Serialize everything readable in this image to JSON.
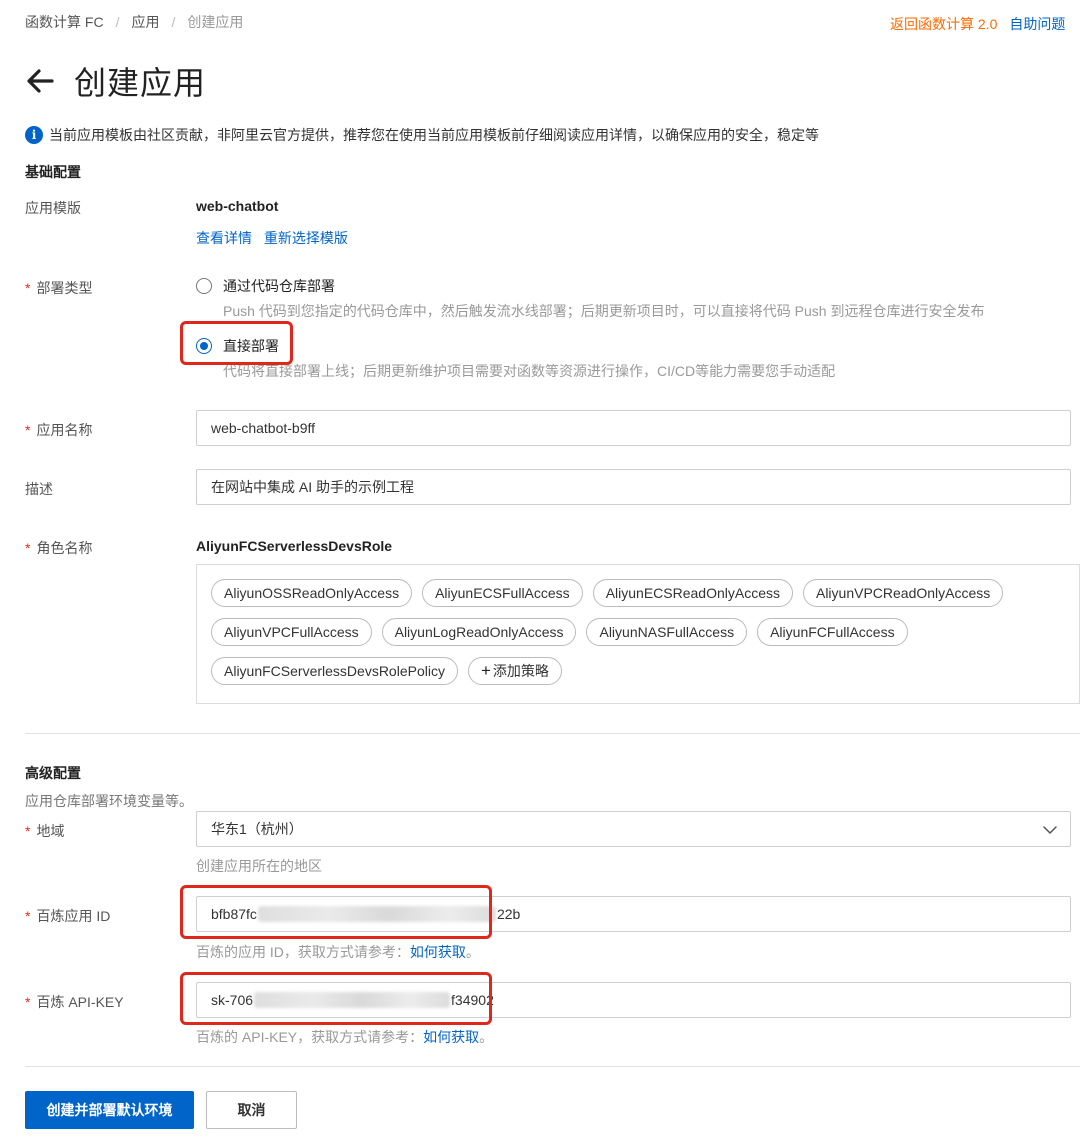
{
  "breadcrumb": {
    "items": [
      "函数计算 FC",
      "应用",
      "创建应用"
    ]
  },
  "top_links": {
    "return_label": "返回函数计算 2.0",
    "help_label": "自助问题"
  },
  "page": {
    "title": "创建应用"
  },
  "notice": "当前应用模板由社区贡献，非阿里云官方提供，推荐您在使用当前应用模板前仔细阅读应用详情，以确保应用的安全，稳定等",
  "basic": {
    "section_title": "基础配置",
    "template": {
      "label": "应用模版",
      "value": "web-chatbot",
      "link_details": "查看详情",
      "link_reselect": "重新选择模版"
    },
    "deploy_type": {
      "label": "部署类型",
      "options": [
        {
          "label": "通过代码仓库部署",
          "desc": "Push 代码到您指定的代码仓库中，然后触发流水线部署；后期更新项目时，可以直接将代码 Push 到远程仓库进行安全发布",
          "checked": false
        },
        {
          "label": "直接部署",
          "desc": "代码将直接部署上线；后期更新维护项目需要对函数等资源进行操作，CI/CD等能力需要您手动适配",
          "checked": true
        }
      ]
    },
    "app_name": {
      "label": "应用名称",
      "value": "web-chatbot-b9ff"
    },
    "description": {
      "label": "描述",
      "value": "在网站中集成 AI 助手的示例工程"
    },
    "role": {
      "label": "角色名称",
      "value": "AliyunFCServerlessDevsRole",
      "policies": [
        "AliyunOSSReadOnlyAccess",
        "AliyunECSFullAccess",
        "AliyunECSReadOnlyAccess",
        "AliyunVPCReadOnlyAccess",
        "AliyunVPCFullAccess",
        "AliyunLogReadOnlyAccess",
        "AliyunNASFullAccess",
        "AliyunFCFullAccess",
        "AliyunFCServerlessDevsRolePolicy"
      ],
      "add_policy_label": "添加策略"
    }
  },
  "advanced": {
    "section_title": "高级配置",
    "subtitle": "应用仓库部署环境变量等。",
    "region": {
      "label": "地域",
      "value": "华东1（杭州）",
      "hint": "创建应用所在的地区"
    },
    "bailian_app_id": {
      "label": "百炼应用 ID",
      "value_prefix": "bfb87fc",
      "value_suffix": "22b",
      "hint_prefix": "百炼的应用 ID，获取方式请参考：",
      "hint_link": "如何获取",
      "hint_suffix": "。"
    },
    "bailian_api_key": {
      "label": "百炼 API-KEY",
      "value_prefix": "sk-706",
      "value_suffix": "f34902",
      "hint_prefix": "百炼的 API-KEY，获取方式请参考：",
      "hint_link": "如何获取",
      "hint_suffix": "。"
    }
  },
  "actions": {
    "primary_label": "创建并部署默认环境",
    "cancel_label": "取消"
  },
  "colors": {
    "primary": "#0064c8",
    "accent_orange": "#ff6a00",
    "required": "#d93026",
    "highlight_box": "#e0271b"
  }
}
